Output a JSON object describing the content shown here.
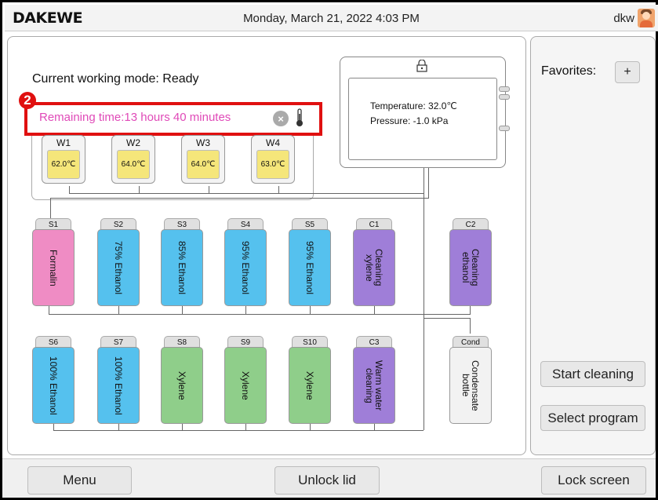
{
  "header": {
    "logo": "DAKEWE",
    "datetime": "Monday, March 21, 2022  4:03 PM",
    "user": "dkw",
    "avatar_icon": "user-avatar-icon"
  },
  "status": {
    "mode": "Current working mode:  Ready",
    "remaining": "Remaining time:13 hours 40 minutes",
    "badge": "2"
  },
  "wells": [
    {
      "label": "W1",
      "temp": "62.0℃"
    },
    {
      "label": "W2",
      "temp": "64.0℃"
    },
    {
      "label": "W3",
      "temp": "64.0℃"
    },
    {
      "label": "W4",
      "temp": "63.0℃"
    }
  ],
  "chamber": {
    "temperature": "Temperature:  32.0℃",
    "pressure": "Pressure:  -1.0 kPa"
  },
  "bottles_row1": [
    {
      "id": "S1",
      "text": "Formalin",
      "color": "#ef8cc4"
    },
    {
      "id": "S2",
      "text": "75% Ethanol",
      "color": "#55c1ee"
    },
    {
      "id": "S3",
      "text": "85% Ethanol",
      "color": "#55c1ee"
    },
    {
      "id": "S4",
      "text": "95% Ethanol",
      "color": "#55c1ee"
    },
    {
      "id": "S5",
      "text": "95% Ethanol",
      "color": "#55c1ee"
    },
    {
      "id": "C1",
      "text": "Cleaning\nxylene",
      "color": "#9f7ed8"
    },
    {
      "id": "C2",
      "text": "Cleaning\nethanol",
      "color": "#9f7ed8"
    }
  ],
  "bottles_row2": [
    {
      "id": "S6",
      "text": "100% Ethanol",
      "color": "#55c1ee"
    },
    {
      "id": "S7",
      "text": "100% Ethanol",
      "color": "#55c1ee"
    },
    {
      "id": "S8",
      "text": "Xylene",
      "color": "#8fce8a"
    },
    {
      "id": "S9",
      "text": "Xylene",
      "color": "#8fce8a"
    },
    {
      "id": "S10",
      "text": "Xylene",
      "color": "#8fce8a"
    },
    {
      "id": "C3",
      "text": "Warm water\ncleaning",
      "color": "#9f7ed8"
    },
    {
      "id": "Cond",
      "text": "Condensate\nbottle",
      "color": "#f2f2f2"
    }
  ],
  "sidebar": {
    "favorites": "Favorites:",
    "add": "+",
    "start_cleaning": "Start cleaning",
    "select_program": "Select program"
  },
  "footer": {
    "menu": "Menu",
    "unlock": "Unlock lid",
    "lock": "Lock screen"
  }
}
